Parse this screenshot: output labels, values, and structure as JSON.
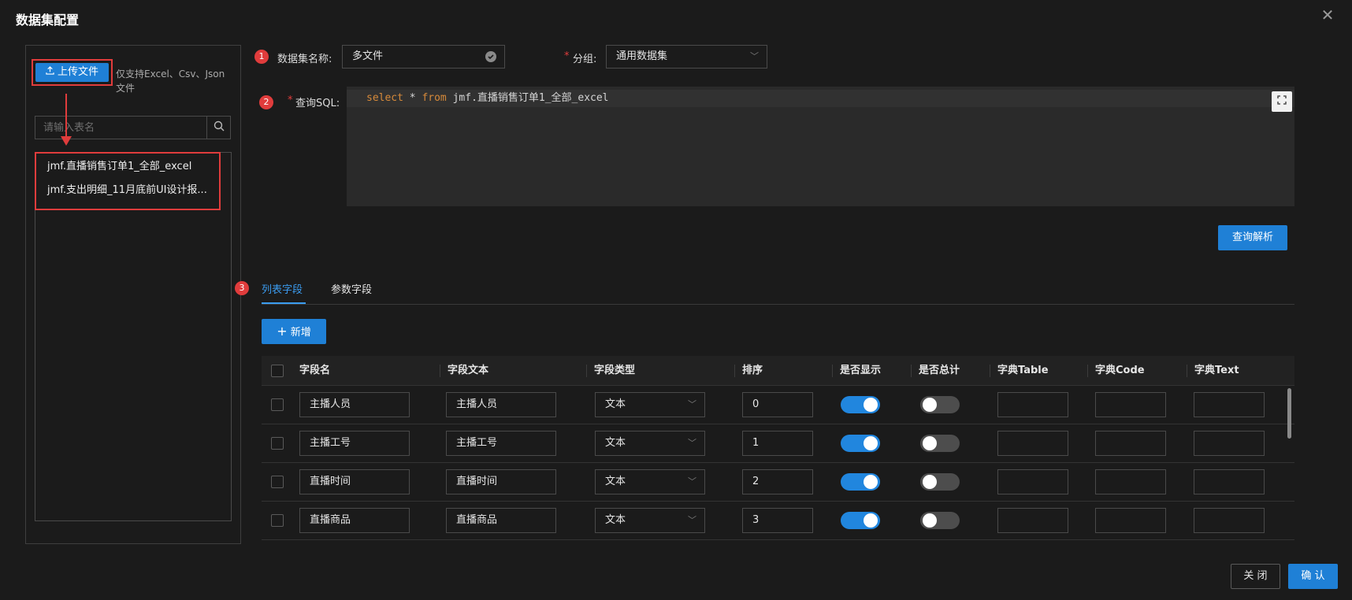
{
  "dialog": {
    "title": "数据集配置",
    "close_glyph": "✕"
  },
  "left_panel": {
    "upload_label": "上传文件",
    "upload_hint": "仅支持Excel、Csv、Json文件",
    "search_placeholder": "请输入表名",
    "tables": [
      "jmf.直播销售订单1_全部_excel",
      "jmf.支出明细_11月底前UI设计报..."
    ]
  },
  "steps": [
    "1",
    "2",
    "3"
  ],
  "form": {
    "name_label": "数据集名称:",
    "name_value": "多文件",
    "group_label": "分组:",
    "group_value": "通用数据集",
    "sql_label": "查询SQL:",
    "sql_kw1": "select",
    "sql_star": " * ",
    "sql_kw2": "from",
    "sql_rest": " jmf.直播销售订单1_全部_excel",
    "parse_button": "查询解析"
  },
  "tabs": {
    "active": "列表字段",
    "inactive": "参数字段"
  },
  "add_button": "新增",
  "table": {
    "headers": [
      "字段名",
      "字段文本",
      "字段类型",
      "排序",
      "是否显示",
      "是否总计",
      "字典Table",
      "字典Code",
      "字典Text"
    ],
    "rows": [
      {
        "name": "主播人员",
        "text": "主播人员",
        "type": "文本",
        "order": "0",
        "show": true,
        "total": false
      },
      {
        "name": "主播工号",
        "text": "主播工号",
        "type": "文本",
        "order": "1",
        "show": true,
        "total": false
      },
      {
        "name": "直播时间",
        "text": "直播时间",
        "type": "文本",
        "order": "2",
        "show": true,
        "total": false
      },
      {
        "name": "直播商品",
        "text": "直播商品",
        "type": "文本",
        "order": "3",
        "show": true,
        "total": false
      }
    ]
  },
  "footer": {
    "close": "关 闭",
    "confirm": "确 认"
  },
  "colors": {
    "accent": "#1f80d6",
    "annotation_red": "#e03c3c",
    "background": "#1b1b1b"
  },
  "icons": [
    "upload-icon",
    "search-icon",
    "check-circle-icon",
    "chevron-down-icon",
    "fullscreen-icon",
    "plus-icon",
    "close-icon"
  ]
}
